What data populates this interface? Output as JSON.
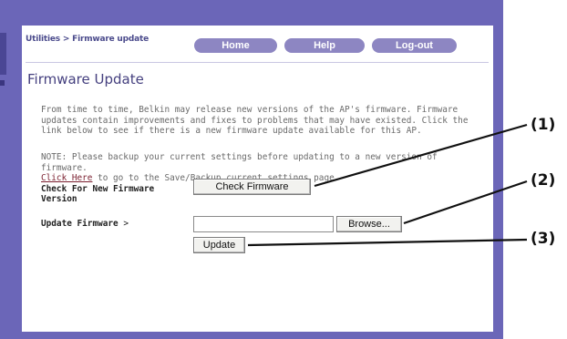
{
  "breadcrumb": "Utilities > Firmware update",
  "nav": {
    "home": "Home",
    "help": "Help",
    "logout": "Log-out"
  },
  "page_title": "Firmware Update",
  "intro": "From time to time, Belkin may release new versions of the AP's firmware. Firmware updates contain improvements and fixes to problems that may have existed. Click the link below to see if there is a new firmware update available for this AP.",
  "note": {
    "text": "NOTE: Please backup your current settings before updating to a new version of firmware.",
    "link": "Click Here",
    "after_link": " to go to the Save/Backup current settings page."
  },
  "check": {
    "label": "Check For New Firmware Version",
    "button": "Check Firmware"
  },
  "update": {
    "label": "Update Firmware",
    "arrow": ">",
    "file_value": "",
    "browse_button": "Browse...",
    "update_button": "Update"
  },
  "callouts": [
    "(1)",
    "(2)",
    "(3)"
  ],
  "colors": {
    "frame": "#6b66b8",
    "nav_pill": "#8d86c2",
    "title": "#45407f",
    "link": "#7a1f2f"
  }
}
